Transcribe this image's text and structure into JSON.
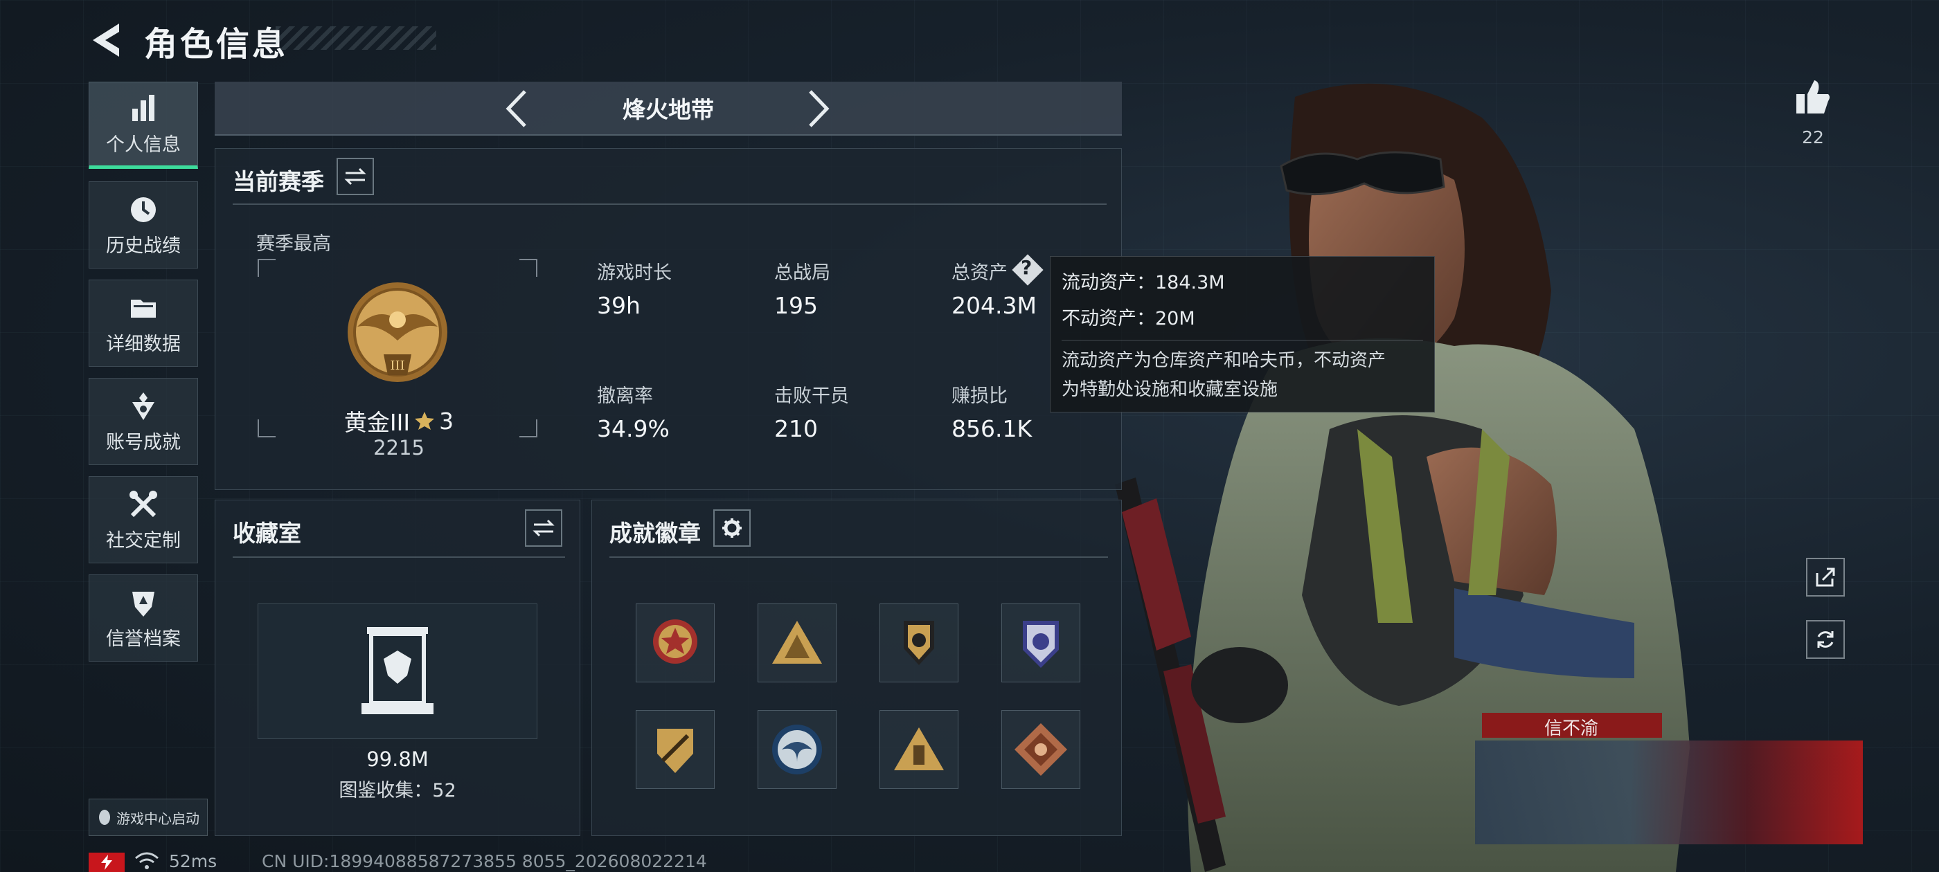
{
  "header": {
    "title": "角色信息"
  },
  "sidebar": {
    "items": [
      {
        "label": "个人信息",
        "icon": "bar-chart-icon",
        "active": true
      },
      {
        "label": "历史战绩",
        "icon": "clock-icon"
      },
      {
        "label": "详细数据",
        "icon": "folder-icon"
      },
      {
        "label": "账号成就",
        "icon": "achievement-icon"
      },
      {
        "label": "社交定制",
        "icon": "tools-icon"
      },
      {
        "label": "信誉档案",
        "icon": "shield-icon"
      }
    ],
    "game_center": "游戏中心启动"
  },
  "mode": {
    "title": "烽火地带"
  },
  "season": {
    "title": "当前赛季",
    "best_label": "赛季最高",
    "rank_name": "黄金III",
    "rank_stars": "3",
    "rank_score": "2215",
    "stats": [
      {
        "label": "游戏时长",
        "value": "39h"
      },
      {
        "label": "总战局",
        "value": "195"
      },
      {
        "label": "总资产",
        "value": "204.3M"
      },
      {
        "label": "撤离率",
        "value": "34.9%"
      },
      {
        "label": "击败干员",
        "value": "210"
      },
      {
        "label": "赚损比",
        "value": "856.1K"
      }
    ]
  },
  "tooltip": {
    "liquid": "流动资产：184.3M",
    "fixed": "不动资产：20M",
    "desc_line1": "流动资产为仓库资产和哈夫币，不动资产",
    "desc_line2": "为特勤处设施和收藏室设施"
  },
  "collection": {
    "title": "收藏室",
    "value": "99.8M",
    "catalog": "图鉴收集：52"
  },
  "badges": {
    "title": "成就徽章",
    "items": [
      "star-medal-icon",
      "triangle-squad-icon",
      "winged-shield-icon",
      "police-badge-icon",
      "wrench-shield-icon",
      "eagle-emblem-icon",
      "triangle-soldier-icon",
      "dragon-diamond-icon"
    ]
  },
  "likes": {
    "count": "22"
  },
  "status": {
    "ping": "52ms",
    "uid": "CN UID:18994088587273855 8055_202608022214"
  },
  "character": {
    "name_tag": "信不渝"
  },
  "colors": {
    "accent": "#3ddc9c",
    "gold": "#c9a052",
    "tooltip_bg": "#14181c"
  }
}
